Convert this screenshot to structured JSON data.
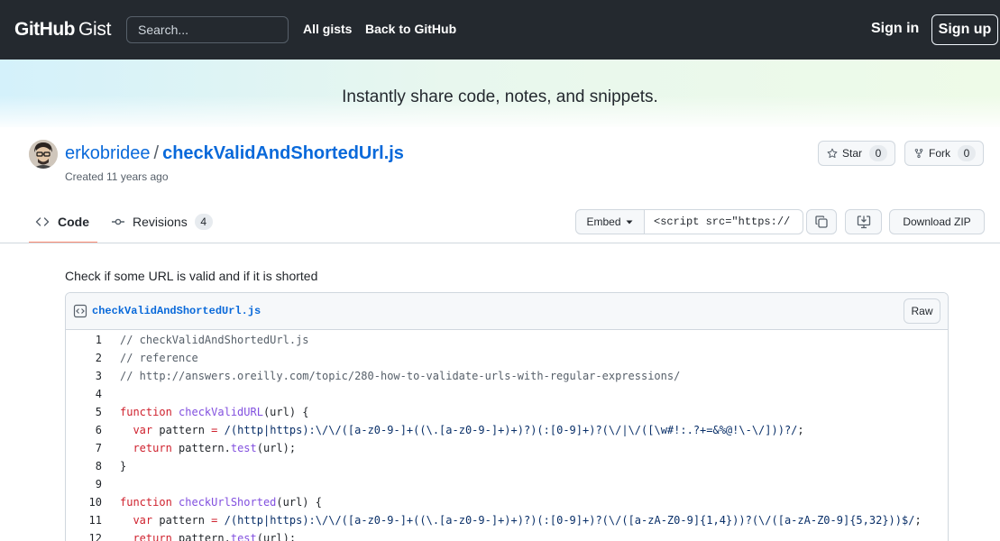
{
  "header": {
    "logo_github": "GitHub",
    "logo_gist": "Gist",
    "search_placeholder": "Search...",
    "nav_all_gists": "All gists",
    "nav_back": "Back to GitHub",
    "sign_in": "Sign in",
    "sign_up": "Sign up"
  },
  "banner": {
    "tagline": "Instantly share code, notes, and snippets."
  },
  "gist": {
    "owner": "erkobridee",
    "separator": "/",
    "filename": "checkValidAndShortedUrl.js",
    "created": "Created 11 years ago",
    "star_label": "Star",
    "star_count": "0",
    "fork_label": "Fork",
    "fork_count": "0"
  },
  "tabs": {
    "code": "Code",
    "revisions": "Revisions",
    "revisions_count": "4"
  },
  "toolbar": {
    "embed_label": "Embed",
    "embed_value": "<script src=\"https://",
    "download_zip": "Download ZIP"
  },
  "description": "Check if some URL is valid and if it is shorted",
  "file": {
    "name": "checkValidAndShortedUrl.js",
    "raw_label": "Raw",
    "lines": [
      {
        "n": "1",
        "text": "// checkValidAndShortedUrl.js"
      },
      {
        "n": "2",
        "text": "// reference"
      },
      {
        "n": "3",
        "text": "// http://answers.oreilly.com/topic/280-how-to-validate-urls-with-regular-expressions/"
      },
      {
        "n": "4",
        "text": ""
      },
      {
        "n": "5",
        "text": "function checkValidURL(url) {"
      },
      {
        "n": "6",
        "text": "  var pattern = /(http|https):\\/\\/([a-z0-9-]+((\\.[a-z0-9-]+)+)?)(:[0-9]+)?(\\/|\\/([\\w#!:.?+=&%@!\\-\\/]))?/;"
      },
      {
        "n": "7",
        "text": "  return pattern.test(url);"
      },
      {
        "n": "8",
        "text": "}"
      },
      {
        "n": "9",
        "text": ""
      },
      {
        "n": "10",
        "text": "function checkUrlShorted(url) {"
      },
      {
        "n": "11",
        "text": "  var pattern = /(http|https):\\/\\/([a-z0-9-]+((\\.[a-z0-9-]+)+)?)(:[0-9]+)?(\\/([a-zA-Z0-9]{1,4}))?(\\/([a-zA-Z0-9]{5,32}))$/;"
      },
      {
        "n": "12",
        "text": "  return pattern.test(url);"
      }
    ]
  },
  "colors": {
    "header_bg": "#24292f",
    "link": "#0969da",
    "active_tab": "#fd8c73",
    "keyword": "#cf222e",
    "function": "#8250df",
    "regex": "#0a3069",
    "comment": "#57606a"
  },
  "icons": [
    "code-icon",
    "revisions-icon",
    "star-icon",
    "fork-icon",
    "copy-icon",
    "desktop-icon",
    "caret-down-icon",
    "file-code-icon"
  ]
}
